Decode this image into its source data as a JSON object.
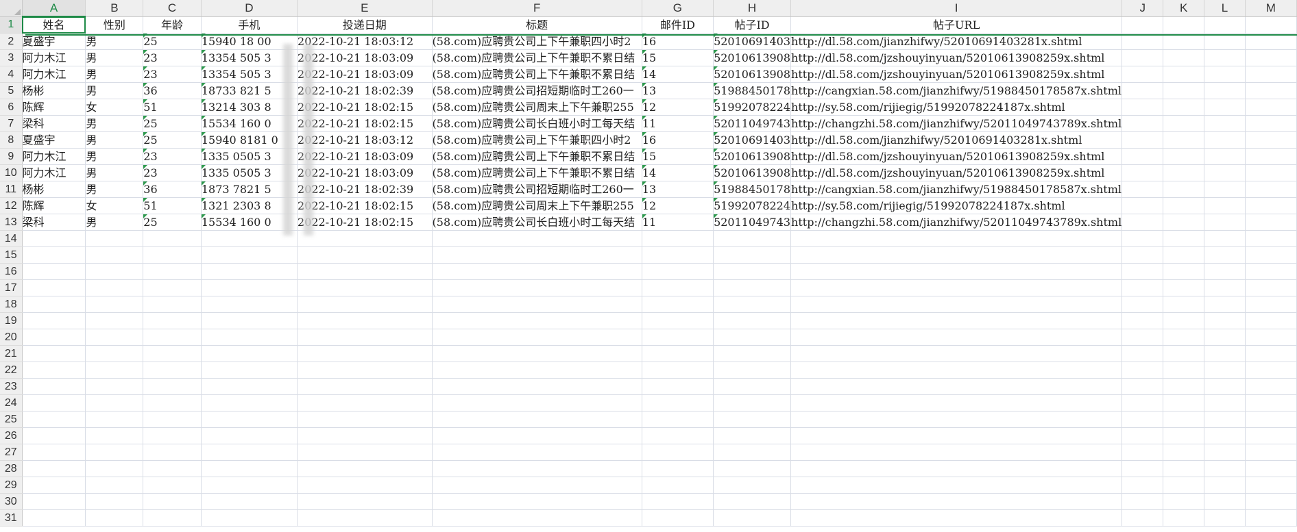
{
  "spreadsheet": {
    "columns": [
      "A",
      "B",
      "C",
      "D",
      "E",
      "F",
      "G",
      "H",
      "I",
      "J",
      "K",
      "L",
      "M"
    ],
    "active_column": "A",
    "active_row": 1,
    "headers": [
      "姓名",
      "性别",
      "年龄",
      "手机",
      "投递日期",
      "标题",
      "邮件ID",
      "帖子ID",
      "帖子URL"
    ],
    "rows": [
      [
        "夏盛宇",
        "男",
        "25",
        "15940  18  00",
        "2022-10-21 18:03:12",
        "(58.com)应聘贵公司上下午兼职四小时2",
        "16",
        "52010691403",
        "http://dl.58.com/jianzhifwy/52010691403281x.shtml"
      ],
      [
        "阿力木江",
        "男",
        "23",
        "13354  505  3",
        "2022-10-21 18:03:09",
        "(58.com)应聘贵公司上下午兼职不累日结",
        "15",
        "52010613908",
        "http://dl.58.com/jzshouyinyuan/52010613908259x.shtml"
      ],
      [
        "阿力木江",
        "男",
        "23",
        "13354  505  3",
        "2022-10-21 18:03:09",
        "(58.com)应聘贵公司上下午兼职不累日结",
        "14",
        "52010613908",
        "http://dl.58.com/jzshouyinyuan/52010613908259x.shtml"
      ],
      [
        "杨彬",
        "男",
        "36",
        "18733  821  5",
        "2022-10-21 18:02:39",
        "(58.com)应聘贵公司招短期临时工260一",
        "13",
        "51988450178",
        "http://cangxian.58.com/jianzhifwy/51988450178587x.shtml"
      ],
      [
        "陈辉",
        "女",
        "51",
        "13214  303  8",
        "2022-10-21 18:02:15",
        "(58.com)应聘贵公司周末上下午兼职255",
        "12",
        "51992078224",
        "http://sy.58.com/rijiegig/51992078224187x.shtml"
      ],
      [
        "梁科",
        "男",
        "25",
        "15534  160  0",
        "2022-10-21 18:02:15",
        "(58.com)应聘贵公司长白班小时工每天结",
        "11",
        "52011049743",
        "http://changzhi.58.com/jianzhifwy/52011049743789x.shtml"
      ],
      [
        "夏盛宇",
        "男",
        "25",
        "15940  8181  0",
        "2022-10-21 18:03:12",
        "(58.com)应聘贵公司上下午兼职四小时2",
        "16",
        "52010691403",
        "http://dl.58.com/jianzhifwy/52010691403281x.shtml"
      ],
      [
        "阿力木江",
        "男",
        "23",
        "1335  0505  3",
        "2022-10-21 18:03:09",
        "(58.com)应聘贵公司上下午兼职不累日结",
        "15",
        "52010613908",
        "http://dl.58.com/jzshouyinyuan/52010613908259x.shtml"
      ],
      [
        "阿力木江",
        "男",
        "23",
        "1335  0505  3",
        "2022-10-21 18:03:09",
        "(58.com)应聘贵公司上下午兼职不累日结",
        "14",
        "52010613908",
        "http://dl.58.com/jzshouyinyuan/52010613908259x.shtml"
      ],
      [
        "杨彬",
        "男",
        "36",
        "1873  7821  5",
        "2022-10-21 18:02:39",
        "(58.com)应聘贵公司招短期临时工260一",
        "13",
        "51988450178",
        "http://cangxian.58.com/jianzhifwy/51988450178587x.shtml"
      ],
      [
        "陈辉",
        "女",
        "51",
        "1321  2303  8",
        "2022-10-21 18:02:15",
        "(58.com)应聘贵公司周末上下午兼职255",
        "12",
        "51992078224",
        "http://sy.58.com/rijiegig/51992078224187x.shtml"
      ],
      [
        "梁科",
        "男",
        "25",
        "15534  160  0",
        "2022-10-21 18:02:15",
        "(58.com)应聘贵公司长白班小时工每天结",
        "11",
        "52011049743",
        "http://changzhi.58.com/jianzhifwy/52011049743789x.shtml"
      ]
    ],
    "total_rows": 31
  },
  "colors": {
    "accent": "#1e8a47",
    "header_bg": "#efefef",
    "gridline": "#d9dde6"
  }
}
